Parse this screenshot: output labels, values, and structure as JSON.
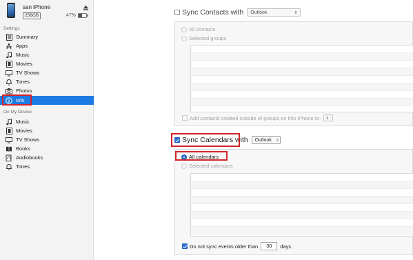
{
  "device": {
    "name": "san iPhone",
    "capacity": "256GB",
    "battery_percent": "47%",
    "battery_level": 0.47,
    "icon": "iphone-icon",
    "eject_icon": "eject-icon"
  },
  "sidebar": {
    "settings_header": "Settings",
    "settings_items": [
      {
        "label": "Summary",
        "icon": "summary-icon"
      },
      {
        "label": "Apps",
        "icon": "apps-icon"
      },
      {
        "label": "Music",
        "icon": "music-note-icon"
      },
      {
        "label": "Movies",
        "icon": "film-icon"
      },
      {
        "label": "TV Shows",
        "icon": "tv-icon"
      },
      {
        "label": "Tones",
        "icon": "bell-icon"
      },
      {
        "label": "Photos",
        "icon": "camera-icon"
      },
      {
        "label": "Info",
        "icon": "info-icon",
        "selected": true
      }
    ],
    "device_header": "On My Device",
    "device_items": [
      {
        "label": "Music",
        "icon": "music-note-icon"
      },
      {
        "label": "Movies",
        "icon": "film-icon"
      },
      {
        "label": "TV Shows",
        "icon": "tv-icon"
      },
      {
        "label": "Books",
        "icon": "book-icon"
      },
      {
        "label": "Audiobooks",
        "icon": "audiobook-icon"
      },
      {
        "label": "Tones",
        "icon": "bell-icon"
      }
    ]
  },
  "contacts": {
    "sync_label": "Sync Contacts with",
    "sync_checked": false,
    "source": "Outlook",
    "option_all": "All contacts",
    "option_selected": "Selected groups",
    "add_outside_label": "Add contacts created outside of groups on this iPhone to:"
  },
  "calendars": {
    "sync_label": "Sync Calendars with",
    "sync_checked": true,
    "source": "Outlook",
    "option_all": "All calendars",
    "option_selected": "Selected calendars",
    "older_than_label": "Do not sync events older than",
    "older_than_checked": true,
    "older_than_value": "30",
    "older_than_unit": "days"
  },
  "colors": {
    "accent": "#1d7be3",
    "highlight_red": "#d2232a"
  }
}
